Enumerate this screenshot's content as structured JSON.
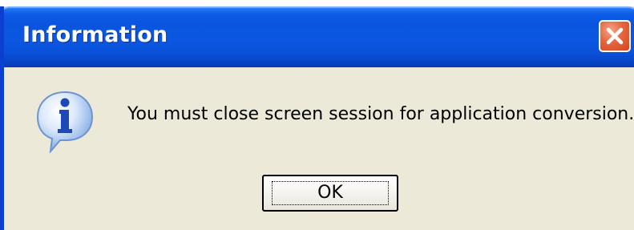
{
  "dialog": {
    "title": "Information",
    "message": "You must close screen session for application conversion.",
    "ok_label": "OK",
    "icon": "information-icon",
    "close_icon": "close-icon"
  },
  "colors": {
    "titlebar": "#0a55de",
    "client_background": "#ece9d8",
    "close_button": "#e6653f"
  }
}
